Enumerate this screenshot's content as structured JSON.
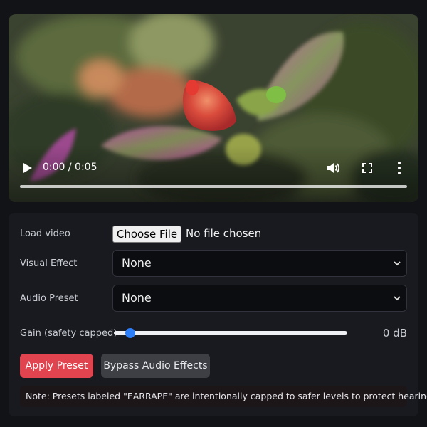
{
  "video": {
    "current_time": "0:00",
    "duration": "0:05",
    "time_display": "0:00 / 0:05",
    "progress_fraction": 0.0,
    "icons": {
      "play": "play-icon",
      "volume": "volume-icon",
      "fullscreen": "fullscreen-icon",
      "more": "more-vertical-icon"
    }
  },
  "controls": {
    "load_video": {
      "label": "Load video",
      "button_label": "Choose File",
      "status": "No file chosen"
    },
    "visual_effect": {
      "label": "Visual Effect",
      "selected": "None"
    },
    "audio_preset": {
      "label": "Audio Preset",
      "selected": "None"
    },
    "gain": {
      "label": "Gain (safety capped)",
      "value_text": "0 dB",
      "slider_fraction": 0.05
    },
    "buttons": {
      "apply": "Apply Preset",
      "bypass": "Bypass Audio Effects"
    },
    "note": "Note: Presets labeled \"EARRAPE\" are intentionally capped to safer levels to protect hearing."
  },
  "colors": {
    "background": "#121317",
    "panel": "#181a1f",
    "apply_button": "#e2444f",
    "bypass_button": "#3d3f45",
    "slider_thumb": "#2d7ff9",
    "note_background": "#1d1619"
  }
}
